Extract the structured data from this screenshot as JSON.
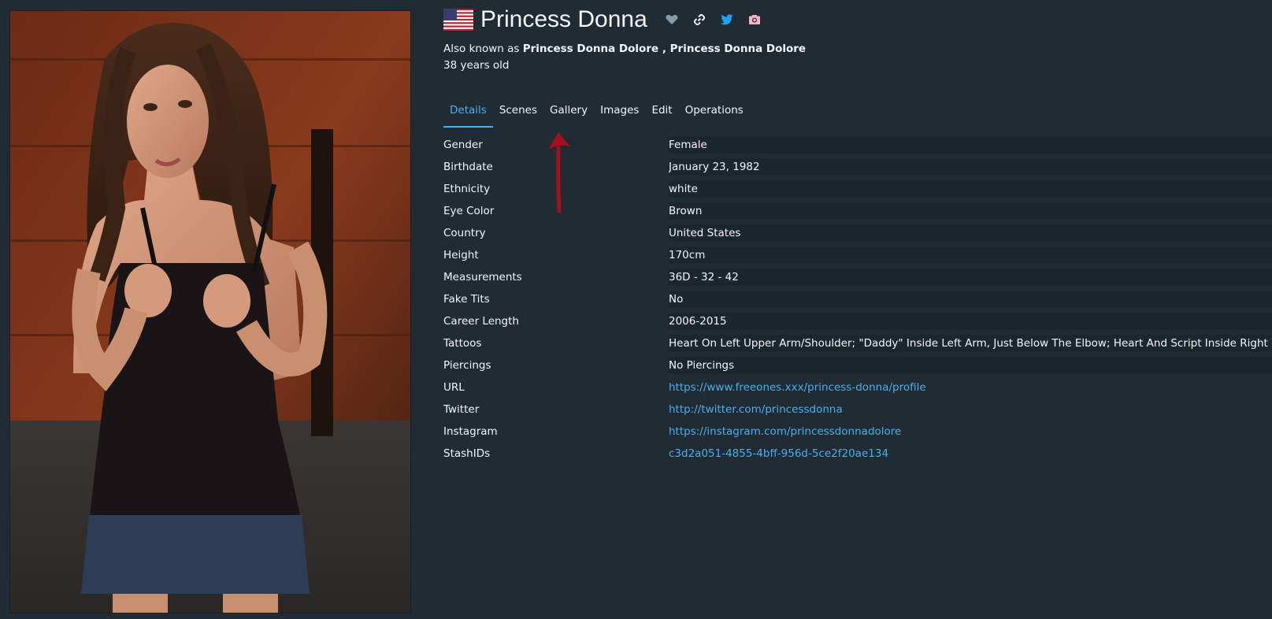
{
  "performer": {
    "name": "Princess Donna",
    "also_known_as_prefix": "Also known as",
    "aliases": "Princess Donna Dolore , Princess Donna Dolore",
    "age": "38 years old"
  },
  "header_icons": [
    "flag-us-icon",
    "heart-icon",
    "link-icon",
    "twitter-icon",
    "instagram-icon"
  ],
  "tabs": [
    {
      "label": "Details",
      "active": true
    },
    {
      "label": "Scenes",
      "active": false
    },
    {
      "label": "Gallery",
      "active": false
    },
    {
      "label": "Images",
      "active": false
    },
    {
      "label": "Edit",
      "active": false
    },
    {
      "label": "Operations",
      "active": false
    }
  ],
  "details": [
    {
      "label": "Gender",
      "value": "Female"
    },
    {
      "label": "Birthdate",
      "value": "January 23, 1982"
    },
    {
      "label": "Ethnicity",
      "value": "white"
    },
    {
      "label": "Eye Color",
      "value": "Brown"
    },
    {
      "label": "Country",
      "value": "United States"
    },
    {
      "label": "Height",
      "value": "170cm"
    },
    {
      "label": "Measurements",
      "value": "36D - 32 - 42"
    },
    {
      "label": "Fake Tits",
      "value": "No"
    },
    {
      "label": "Career Length",
      "value": "2006-2015"
    },
    {
      "label": "Tattoos",
      "value": "Heart On Left Upper Arm/Shoulder; \"Daddy\" Inside Left Arm, Just Below The Elbow; Heart And Script Inside Right Wrist"
    },
    {
      "label": "Piercings",
      "value": "No Piercings"
    },
    {
      "label": "URL",
      "value": "https://www.freeones.xxx/princess-donna/profile"
    },
    {
      "label": "Twitter",
      "value": "http://twitter.com/princessdonna"
    },
    {
      "label": "Instagram",
      "value": "https://instagram.com/princessdonnadolore"
    },
    {
      "label": "StashIDs",
      "value": "c3d2a051-4855-4bff-956d-5ce2f20ae134"
    }
  ],
  "colors": {
    "background": "#202b33",
    "accent": "#48aff0",
    "text": "#f5f8fa",
    "heart": "#8a9ba8",
    "twitter": "#1da1f2",
    "instagram": "#f7b5c3",
    "annotation_arrow": "#a0101e"
  }
}
